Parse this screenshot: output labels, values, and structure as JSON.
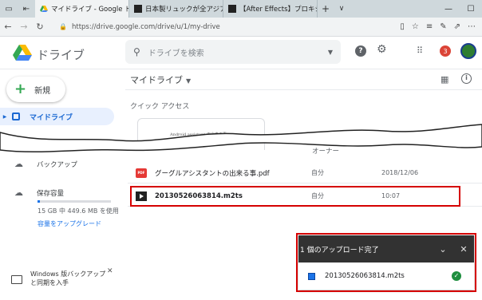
{
  "browser": {
    "tabs": [
      {
        "label": "マイドライブ - Google ドラ",
        "active": true
      },
      {
        "label": "日本製リュックが全アジアで大ヒ",
        "active": false
      },
      {
        "label": "【After Effects】プロキシ動画で",
        "active": false
      }
    ],
    "url": "https://drive.google.com/drive/u/1/my-drive"
  },
  "drive": {
    "brand": "ドライブ",
    "search_placeholder": "ドライブを検索",
    "notification_count": "3"
  },
  "sidebar": {
    "new_label": "新規",
    "my_drive_label": "マイドライブ",
    "backup_label": "バックアップ",
    "storage_label": "保存容量",
    "storage_used_fraction": 0.03,
    "storage_text": "15 GB 中 449.6 MB を使用",
    "upgrade_link": "容量をアップグレード",
    "backup_promo": [
      "Windows 版バックアップ",
      "と同期を入手"
    ]
  },
  "main": {
    "title": "マイドライブ",
    "quick_access": "クイック アクセス",
    "quick_card_doc": "Android assistant の出来る事",
    "owner_header": "オーナー",
    "files": [
      {
        "name": "グーグルアシスタントの出来る事.pdf",
        "owner": "自分",
        "modified": "2018/12/06",
        "type": "pdf"
      },
      {
        "name": "20130526063814.m2ts",
        "owner": "自分",
        "modified": "10:07",
        "type": "video"
      }
    ]
  },
  "upload_panel": {
    "title": "1 個のアップロード完了",
    "file": "20130526063814.m2ts"
  }
}
